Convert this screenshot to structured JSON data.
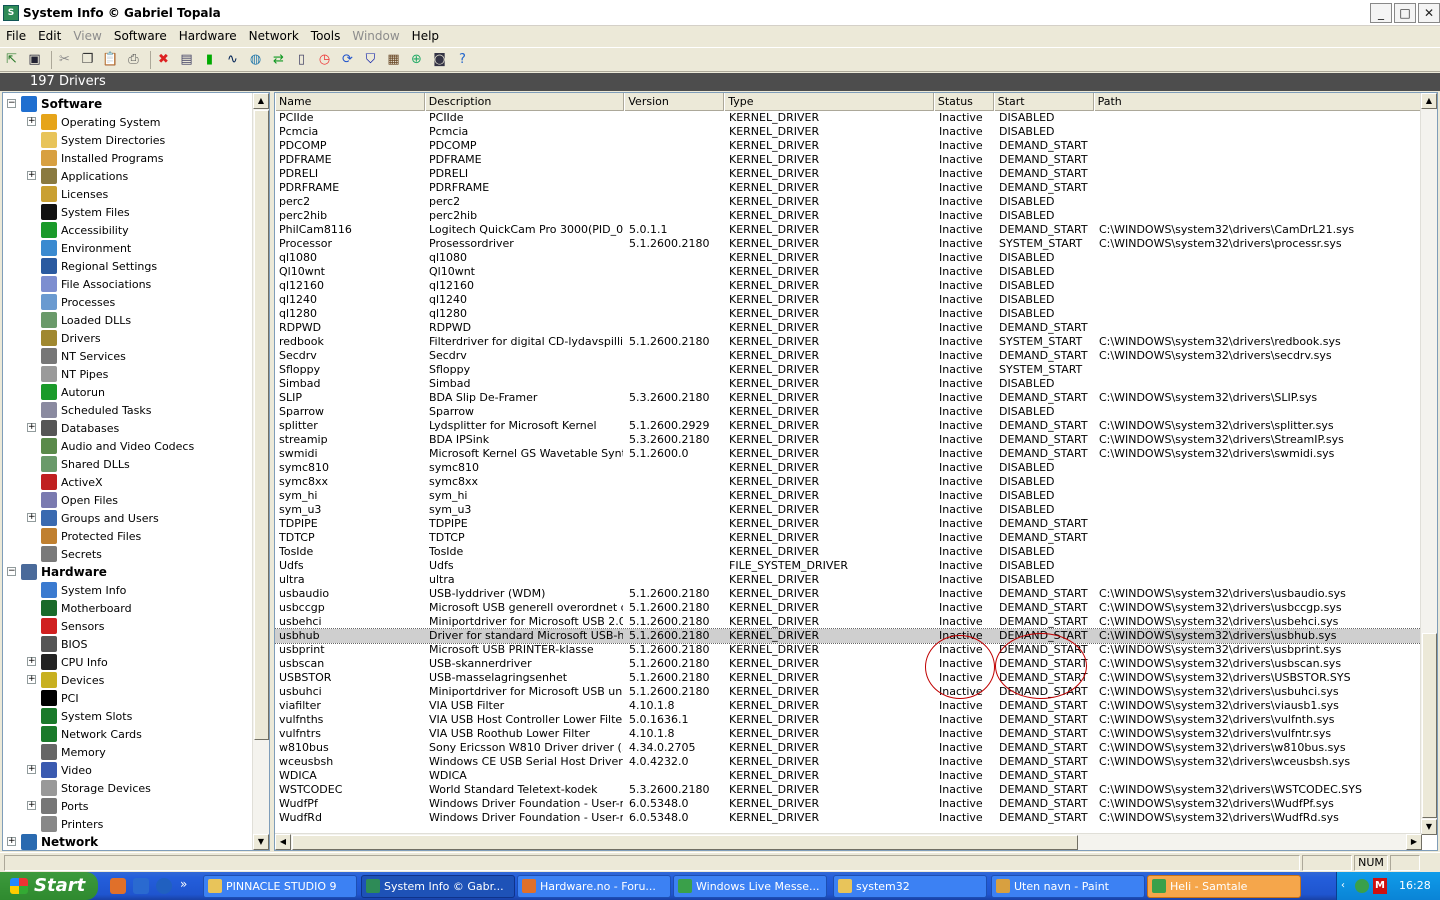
{
  "window": {
    "title": "System Info  © Gabriel Topala",
    "min": "_",
    "max": "□",
    "close": "✕"
  },
  "menu": [
    {
      "label": "File",
      "disabled": false
    },
    {
      "label": "Edit",
      "disabled": false
    },
    {
      "label": "View",
      "disabled": true
    },
    {
      "label": "Software",
      "disabled": false
    },
    {
      "label": "Hardware",
      "disabled": false
    },
    {
      "label": "Network",
      "disabled": false
    },
    {
      "label": "Tools",
      "disabled": false
    },
    {
      "label": "Window",
      "disabled": true
    },
    {
      "label": "Help",
      "disabled": false
    }
  ],
  "toolbar": [
    {
      "icon": "exit-icon",
      "glyph": "⇱",
      "color": "#2a7a2a"
    },
    {
      "icon": "save-icon",
      "glyph": "▣",
      "color": "#223"
    },
    {
      "sep": true
    },
    {
      "icon": "cut-icon",
      "glyph": "✂",
      "color": "#888"
    },
    {
      "icon": "copy-icon",
      "glyph": "❐",
      "color": "#333"
    },
    {
      "icon": "paste-icon",
      "glyph": "📋",
      "color": "#888"
    },
    {
      "icon": "print-icon",
      "glyph": "⎙",
      "color": "#555"
    },
    {
      "sep": true
    },
    {
      "icon": "stop-icon",
      "glyph": "✖",
      "color": "#d22"
    },
    {
      "icon": "report-icon",
      "glyph": "▤",
      "color": "#446"
    },
    {
      "icon": "cpu-bar-icon",
      "glyph": "▮",
      "color": "#0a0"
    },
    {
      "icon": "wave-icon",
      "glyph": "∿",
      "color": "#025"
    },
    {
      "icon": "globe-icon",
      "glyph": "◍",
      "color": "#27a"
    },
    {
      "icon": "sync-icon",
      "glyph": "⇄",
      "color": "#192"
    },
    {
      "icon": "document-icon",
      "glyph": "▯",
      "color": "#446"
    },
    {
      "icon": "clock-icon",
      "glyph": "◷",
      "color": "#e33"
    },
    {
      "icon": "refresh-icon",
      "glyph": "⟳",
      "color": "#25c"
    },
    {
      "icon": "shield-icon",
      "glyph": "⛉",
      "color": "#12a"
    },
    {
      "icon": "grid-icon",
      "glyph": "▦",
      "color": "#642"
    },
    {
      "icon": "network-icon",
      "glyph": "⊕",
      "color": "#2a6"
    },
    {
      "icon": "info-window-icon",
      "glyph": "◙",
      "color": "#334"
    },
    {
      "icon": "help-icon",
      "glyph": "?",
      "color": "#26c"
    }
  ],
  "header": {
    "text": "197 Drivers"
  },
  "tree": [
    {
      "label": "Software",
      "level": 0,
      "exp": "−",
      "icon": "software-icon",
      "color": "#1f6fd0",
      "bold": true
    },
    {
      "label": "Operating System",
      "level": 1,
      "exp": "+",
      "icon": "windows-icon",
      "color": "#e6a419"
    },
    {
      "label": "System Directories",
      "level": 1,
      "icon": "folder-icon",
      "color": "#e8c45a"
    },
    {
      "label": "Installed Programs",
      "level": 1,
      "icon": "programs-icon",
      "color": "#d8a040"
    },
    {
      "label": "Applications",
      "level": 1,
      "exp": "+",
      "icon": "applications-icon",
      "color": "#8a7a40"
    },
    {
      "label": "Licenses",
      "level": 1,
      "icon": "lock-icon",
      "color": "#c9a032"
    },
    {
      "label": "System Files",
      "level": 1,
      "icon": "console-icon",
      "color": "#111"
    },
    {
      "label": "Accessibility",
      "level": 1,
      "icon": "accessibility-icon",
      "color": "#1a9a2a"
    },
    {
      "label": "Environment",
      "level": 1,
      "icon": "environment-icon",
      "color": "#3a8ad0"
    },
    {
      "label": "Regional Settings",
      "level": 1,
      "icon": "regional-icon",
      "color": "#2a5aa0"
    },
    {
      "label": "File Associations",
      "level": 1,
      "icon": "file-associations-icon",
      "color": "#7d8ed0"
    },
    {
      "label": "Processes",
      "level": 1,
      "icon": "processes-icon",
      "color": "#6a9ad0"
    },
    {
      "label": "Loaded DLLs",
      "level": 1,
      "icon": "dll-icon",
      "color": "#6a9a6a"
    },
    {
      "label": "Drivers",
      "level": 1,
      "icon": "drivers-icon",
      "color": "#a08830"
    },
    {
      "label": "NT Services",
      "level": 1,
      "icon": "services-icon",
      "color": "#777"
    },
    {
      "label": "NT Pipes",
      "level": 1,
      "icon": "pipes-icon",
      "color": "#9a9a9a"
    },
    {
      "label": "Autorun",
      "level": 1,
      "icon": "autorun-icon",
      "color": "#1a9a2a"
    },
    {
      "label": "Scheduled Tasks",
      "level": 1,
      "icon": "scheduled-tasks-icon",
      "color": "#8a8aa0"
    },
    {
      "label": "Databases",
      "level": 1,
      "exp": "+",
      "icon": "databases-icon",
      "color": "#555"
    },
    {
      "label": "Audio and Video Codecs",
      "level": 1,
      "icon": "codecs-icon",
      "color": "#5a8a4a"
    },
    {
      "label": "Shared DLLs",
      "level": 1,
      "icon": "shared-dll-icon",
      "color": "#6a9a6a"
    },
    {
      "label": "ActiveX",
      "level": 1,
      "icon": "activex-icon",
      "color": "#c02020"
    },
    {
      "label": "Open Files",
      "level": 1,
      "icon": "open-files-icon",
      "color": "#7a7ab0"
    },
    {
      "label": "Groups and Users",
      "level": 1,
      "exp": "+",
      "icon": "users-icon",
      "color": "#3a6ab0"
    },
    {
      "label": "Protected Files",
      "level": 1,
      "icon": "protected-files-icon",
      "color": "#c08030"
    },
    {
      "label": "Secrets",
      "level": 1,
      "icon": "secrets-icon",
      "color": "#7a7a7a"
    },
    {
      "label": "Hardware",
      "level": 0,
      "exp": "−",
      "icon": "hardware-icon",
      "color": "#4a6a9a",
      "bold": true
    },
    {
      "label": "System Info",
      "level": 1,
      "icon": "system-info-icon",
      "color": "#3a7ad0"
    },
    {
      "label": "Motherboard",
      "level": 1,
      "icon": "motherboard-icon",
      "color": "#1a6a2a"
    },
    {
      "label": "Sensors",
      "level": 1,
      "icon": "thermometer-icon",
      "color": "#d02020"
    },
    {
      "label": "BIOS",
      "level": 1,
      "icon": "bios-icon",
      "color": "#555"
    },
    {
      "label": "CPU Info",
      "level": 1,
      "exp": "+",
      "icon": "cpu-icon",
      "color": "#222"
    },
    {
      "label": "Devices",
      "level": 1,
      "exp": "+",
      "icon": "devices-icon",
      "color": "#c8b020"
    },
    {
      "label": "PCI",
      "level": 1,
      "icon": "pci-icon",
      "color": "#000"
    },
    {
      "label": "System Slots",
      "level": 1,
      "icon": "slots-icon",
      "color": "#1a7a2a"
    },
    {
      "label": "Network Cards",
      "level": 1,
      "icon": "network-card-icon",
      "color": "#1a7a2a"
    },
    {
      "label": "Memory",
      "level": 1,
      "icon": "memory-icon",
      "color": "#666"
    },
    {
      "label": "Video",
      "level": 1,
      "exp": "+",
      "icon": "video-icon",
      "color": "#3a5ab0"
    },
    {
      "label": "Storage Devices",
      "level": 1,
      "icon": "storage-icon",
      "color": "#999"
    },
    {
      "label": "Ports",
      "level": 1,
      "exp": "+",
      "icon": "ports-icon",
      "color": "#777"
    },
    {
      "label": "Printers",
      "level": 1,
      "icon": "printer-icon",
      "color": "#888"
    },
    {
      "label": "Network",
      "level": 0,
      "exp": "+",
      "icon": "network-tree-icon",
      "color": "#2a6ab0",
      "bold": true
    }
  ],
  "columns": [
    "Name",
    "Description",
    "Version",
    "Type",
    "Status",
    "Start",
    "Path"
  ],
  "rows": [
    [
      "PCIIde",
      "PCIIde",
      "",
      "KERNEL_DRIVER",
      "Inactive",
      "DISABLED",
      ""
    ],
    [
      "Pcmcia",
      "Pcmcia",
      "",
      "KERNEL_DRIVER",
      "Inactive",
      "DISABLED",
      ""
    ],
    [
      "PDCOMP",
      "PDCOMP",
      "",
      "KERNEL_DRIVER",
      "Inactive",
      "DEMAND_START",
      ""
    ],
    [
      "PDFRAME",
      "PDFRAME",
      "",
      "KERNEL_DRIVER",
      "Inactive",
      "DEMAND_START",
      ""
    ],
    [
      "PDRELI",
      "PDRELI",
      "",
      "KERNEL_DRIVER",
      "Inactive",
      "DEMAND_START",
      ""
    ],
    [
      "PDRFRAME",
      "PDRFRAME",
      "",
      "KERNEL_DRIVER",
      "Inactive",
      "DEMAND_START",
      ""
    ],
    [
      "perc2",
      "perc2",
      "",
      "KERNEL_DRIVER",
      "Inactive",
      "DISABLED",
      ""
    ],
    [
      "perc2hib",
      "perc2hib",
      "",
      "KERNEL_DRIVER",
      "Inactive",
      "DISABLED",
      ""
    ],
    [
      "PhilCam8116",
      "Logitech QuickCam Pro 3000(PID_08...",
      "5.0.1.1",
      "KERNEL_DRIVER",
      "Inactive",
      "DEMAND_START",
      "C:\\WINDOWS\\system32\\drivers\\CamDrL21.sys"
    ],
    [
      "Processor",
      "Prosessordriver",
      "5.1.2600.2180",
      "KERNEL_DRIVER",
      "Inactive",
      "SYSTEM_START",
      "C:\\WINDOWS\\system32\\drivers\\processr.sys"
    ],
    [
      "ql1080",
      "ql1080",
      "",
      "KERNEL_DRIVER",
      "Inactive",
      "DISABLED",
      ""
    ],
    [
      "Ql10wnt",
      "Ql10wnt",
      "",
      "KERNEL_DRIVER",
      "Inactive",
      "DISABLED",
      ""
    ],
    [
      "ql12160",
      "ql12160",
      "",
      "KERNEL_DRIVER",
      "Inactive",
      "DISABLED",
      ""
    ],
    [
      "ql1240",
      "ql1240",
      "",
      "KERNEL_DRIVER",
      "Inactive",
      "DISABLED",
      ""
    ],
    [
      "ql1280",
      "ql1280",
      "",
      "KERNEL_DRIVER",
      "Inactive",
      "DISABLED",
      ""
    ],
    [
      "RDPWD",
      "RDPWD",
      "",
      "KERNEL_DRIVER",
      "Inactive",
      "DEMAND_START",
      ""
    ],
    [
      "redbook",
      "Filterdriver for digital CD-lydavspilling",
      "5.1.2600.2180",
      "KERNEL_DRIVER",
      "Inactive",
      "SYSTEM_START",
      "C:\\WINDOWS\\system32\\drivers\\redbook.sys"
    ],
    [
      "Secdrv",
      "Secdrv",
      "",
      "KERNEL_DRIVER",
      "Inactive",
      "DEMAND_START",
      "C:\\WINDOWS\\system32\\drivers\\secdrv.sys"
    ],
    [
      "Sfloppy",
      "Sfloppy",
      "",
      "KERNEL_DRIVER",
      "Inactive",
      "SYSTEM_START",
      ""
    ],
    [
      "Simbad",
      "Simbad",
      "",
      "KERNEL_DRIVER",
      "Inactive",
      "DISABLED",
      ""
    ],
    [
      "SLIP",
      "BDA Slip De-Framer",
      "5.3.2600.2180",
      "KERNEL_DRIVER",
      "Inactive",
      "DEMAND_START",
      "C:\\WINDOWS\\system32\\drivers\\SLIP.sys"
    ],
    [
      "Sparrow",
      "Sparrow",
      "",
      "KERNEL_DRIVER",
      "Inactive",
      "DISABLED",
      ""
    ],
    [
      "splitter",
      "Lydsplitter for Microsoft Kernel",
      "5.1.2600.2929",
      "KERNEL_DRIVER",
      "Inactive",
      "DEMAND_START",
      "C:\\WINDOWS\\system32\\drivers\\splitter.sys"
    ],
    [
      "streamip",
      "BDA IPSink",
      "5.3.2600.2180",
      "KERNEL_DRIVER",
      "Inactive",
      "DEMAND_START",
      "C:\\WINDOWS\\system32\\drivers\\StreamIP.sys"
    ],
    [
      "swmidi",
      "Microsoft Kernel GS Wavetable Synt...",
      "5.1.2600.0",
      "KERNEL_DRIVER",
      "Inactive",
      "DEMAND_START",
      "C:\\WINDOWS\\system32\\drivers\\swmidi.sys"
    ],
    [
      "symc810",
      "symc810",
      "",
      "KERNEL_DRIVER",
      "Inactive",
      "DISABLED",
      ""
    ],
    [
      "symc8xx",
      "symc8xx",
      "",
      "KERNEL_DRIVER",
      "Inactive",
      "DISABLED",
      ""
    ],
    [
      "sym_hi",
      "sym_hi",
      "",
      "KERNEL_DRIVER",
      "Inactive",
      "DISABLED",
      ""
    ],
    [
      "sym_u3",
      "sym_u3",
      "",
      "KERNEL_DRIVER",
      "Inactive",
      "DISABLED",
      ""
    ],
    [
      "TDPIPE",
      "TDPIPE",
      "",
      "KERNEL_DRIVER",
      "Inactive",
      "DEMAND_START",
      ""
    ],
    [
      "TDTCP",
      "TDTCP",
      "",
      "KERNEL_DRIVER",
      "Inactive",
      "DEMAND_START",
      ""
    ],
    [
      "TosIde",
      "TosIde",
      "",
      "KERNEL_DRIVER",
      "Inactive",
      "DISABLED",
      ""
    ],
    [
      "Udfs",
      "Udfs",
      "",
      "FILE_SYSTEM_DRIVER",
      "Inactive",
      "DISABLED",
      ""
    ],
    [
      "ultra",
      "ultra",
      "",
      "KERNEL_DRIVER",
      "Inactive",
      "DISABLED",
      ""
    ],
    [
      "usbaudio",
      "USB-lyddriver (WDM)",
      "5.1.2600.2180",
      "KERNEL_DRIVER",
      "Inactive",
      "DEMAND_START",
      "C:\\WINDOWS\\system32\\drivers\\usbaudio.sys"
    ],
    [
      "usbccgp",
      "Microsoft USB generell overordnet d...",
      "5.1.2600.2180",
      "KERNEL_DRIVER",
      "Inactive",
      "DEMAND_START",
      "C:\\WINDOWS\\system32\\drivers\\usbccgp.sys"
    ],
    [
      "usbehci",
      "Miniportdriver for Microsoft USB 2.0 ...",
      "5.1.2600.2180",
      "KERNEL_DRIVER",
      "Inactive",
      "DEMAND_START",
      "C:\\WINDOWS\\system32\\drivers\\usbehci.sys"
    ],
    [
      "usbhub",
      "Driver for standard Microsoft USB-hub",
      "5.1.2600.2180",
      "KERNEL_DRIVER",
      "Inactive",
      "DEMAND_START",
      "C:\\WINDOWS\\system32\\drivers\\usbhub.sys"
    ],
    [
      "usbprint",
      "Microsoft USB PRINTER-klasse",
      "5.1.2600.2180",
      "KERNEL_DRIVER",
      "Inactive",
      "DEMAND_START",
      "C:\\WINDOWS\\system32\\drivers\\usbprint.sys"
    ],
    [
      "usbscan",
      "USB-skannerdriver",
      "5.1.2600.2180",
      "KERNEL_DRIVER",
      "Inactive",
      "DEMAND_START",
      "C:\\WINDOWS\\system32\\drivers\\usbscan.sys"
    ],
    [
      "USBSTOR",
      "USB-masselagringsenhet",
      "5.1.2600.2180",
      "KERNEL_DRIVER",
      "Inactive",
      "DEMAND_START",
      "C:\\WINDOWS\\system32\\drivers\\USBSTOR.SYS"
    ],
    [
      "usbuhci",
      "Miniportdriver for Microsoft USB univ...",
      "5.1.2600.2180",
      "KERNEL_DRIVER",
      "Inactive",
      "DEMAND_START",
      "C:\\WINDOWS\\system32\\drivers\\usbuhci.sys"
    ],
    [
      "viafilter",
      "VIA USB Filter",
      "4.10.1.8",
      "KERNEL_DRIVER",
      "Inactive",
      "DEMAND_START",
      "C:\\WINDOWS\\system32\\drivers\\viausb1.sys"
    ],
    [
      "vulfnths",
      "VIA USB Host Controller Lower Filter",
      "5.0.1636.1",
      "KERNEL_DRIVER",
      "Inactive",
      "DEMAND_START",
      "C:\\WINDOWS\\system32\\drivers\\vulfnth.sys"
    ],
    [
      "vulfntrs",
      "VIA USB Roothub Lower Filter",
      "4.10.1.8",
      "KERNEL_DRIVER",
      "Inactive",
      "DEMAND_START",
      "C:\\WINDOWS\\system32\\drivers\\vulfntr.sys"
    ],
    [
      "w810bus",
      "Sony Ericsson W810 Driver driver (...",
      "4.34.0.2705",
      "KERNEL_DRIVER",
      "Inactive",
      "DEMAND_START",
      "C:\\WINDOWS\\system32\\drivers\\w810bus.sys"
    ],
    [
      "wceusbsh",
      "Windows CE USB Serial Host Driver",
      "4.0.4232.0",
      "KERNEL_DRIVER",
      "Inactive",
      "DEMAND_START",
      "C:\\WINDOWS\\system32\\drivers\\wceusbsh.sys"
    ],
    [
      "WDICA",
      "WDICA",
      "",
      "KERNEL_DRIVER",
      "Inactive",
      "DEMAND_START",
      ""
    ],
    [
      "WSTCODEC",
      "World Standard Teletext-kodek",
      "5.3.2600.2180",
      "KERNEL_DRIVER",
      "Inactive",
      "DEMAND_START",
      "C:\\WINDOWS\\system32\\drivers\\WSTCODEC.SYS"
    ],
    [
      "WudfPf",
      "Windows Driver Foundation - User-m...",
      "6.0.5348.0",
      "KERNEL_DRIVER",
      "Inactive",
      "DEMAND_START",
      "C:\\WINDOWS\\system32\\drivers\\WudfPf.sys"
    ],
    [
      "WudfRd",
      "Windows Driver Foundation - User-m...",
      "6.0.5348.0",
      "KERNEL_DRIVER",
      "Inactive",
      "DEMAND_START",
      "C:\\WINDOWS\\system32\\drivers\\WudfRd.sys"
    ]
  ],
  "selected_row": "usbhub",
  "statusbar": {
    "num": "NUM"
  },
  "taskbar": {
    "start": "Start",
    "tasks": [
      {
        "label": "PINNACLE STUDIO 9",
        "icon": "folder-task-icon",
        "color": "#e8c45a",
        "state": ""
      },
      {
        "label": "System Info  © Gabr...",
        "icon": "systeminfo-task-icon",
        "color": "#2e8b57",
        "state": "active"
      },
      {
        "label": "Hardware.no - Foru...",
        "icon": "firefox-task-icon",
        "color": "#e0702a",
        "state": ""
      },
      {
        "label": "Windows Live Messe...",
        "icon": "messenger-task-icon",
        "color": "#3aa04a",
        "state": ""
      },
      {
        "label": "system32",
        "icon": "folder-task-icon",
        "color": "#e8c45a",
        "state": ""
      },
      {
        "label": "Uten navn - Paint",
        "icon": "paint-task-icon",
        "color": "#d8a040",
        "state": ""
      },
      {
        "label": "Heli - Samtale",
        "icon": "conversation-task-icon",
        "color": "#3aa04a",
        "state": "flash"
      }
    ],
    "clock": "16:28"
  }
}
